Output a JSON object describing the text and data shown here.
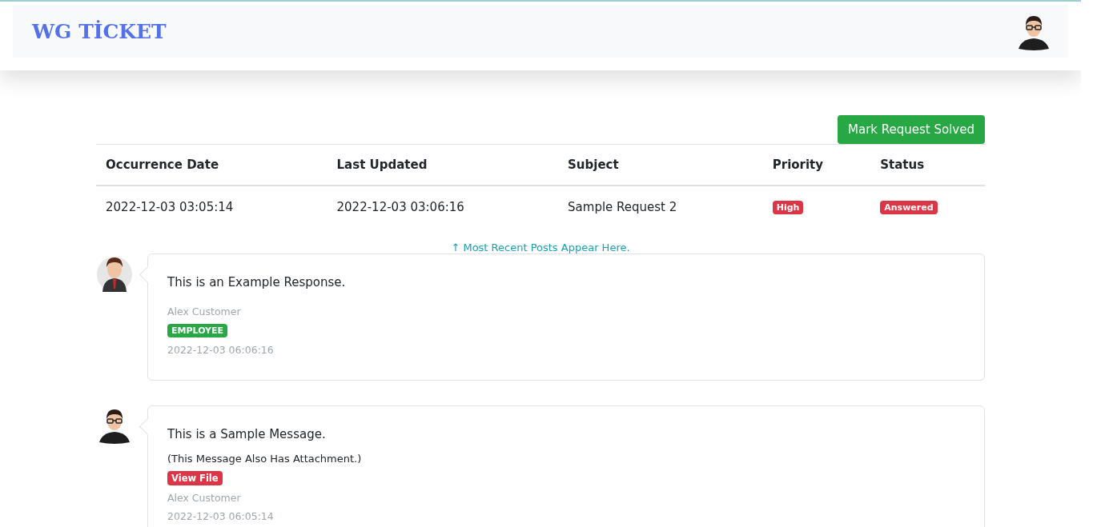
{
  "brand": "WG TİCKET",
  "actions": {
    "solve_button": "Mark Request Solved"
  },
  "table": {
    "columns": [
      "Occurrence Date",
      "Last Updated",
      "Subject",
      "Priority",
      "Status"
    ],
    "rows": [
      {
        "occurrence_date": "2022-12-03 03:05:14",
        "last_updated": "2022-12-03 03:06:16",
        "subject": "Sample Request 2",
        "priority": {
          "label": "High",
          "color": "#dc3545"
        },
        "status": {
          "label": "Answered",
          "color": "#dc3545"
        }
      }
    ]
  },
  "posts_note": "↑ Most Recent Posts Appear Here.",
  "posts": [
    {
      "kind": "employee",
      "message": "This is an Example Response.",
      "author": "Alex Customer",
      "role_badge": {
        "label": "EMPLOYEE",
        "color": "#28a745"
      },
      "time": "2022-12-03 06:06:16"
    },
    {
      "kind": "customer",
      "message": "This is a Sample Message.",
      "attachment_note": "(This Message Also Has Attachment.)",
      "attachment_link": "View File",
      "author": "Alex Customer",
      "time": "2022-12-03 06:05:14"
    }
  ]
}
